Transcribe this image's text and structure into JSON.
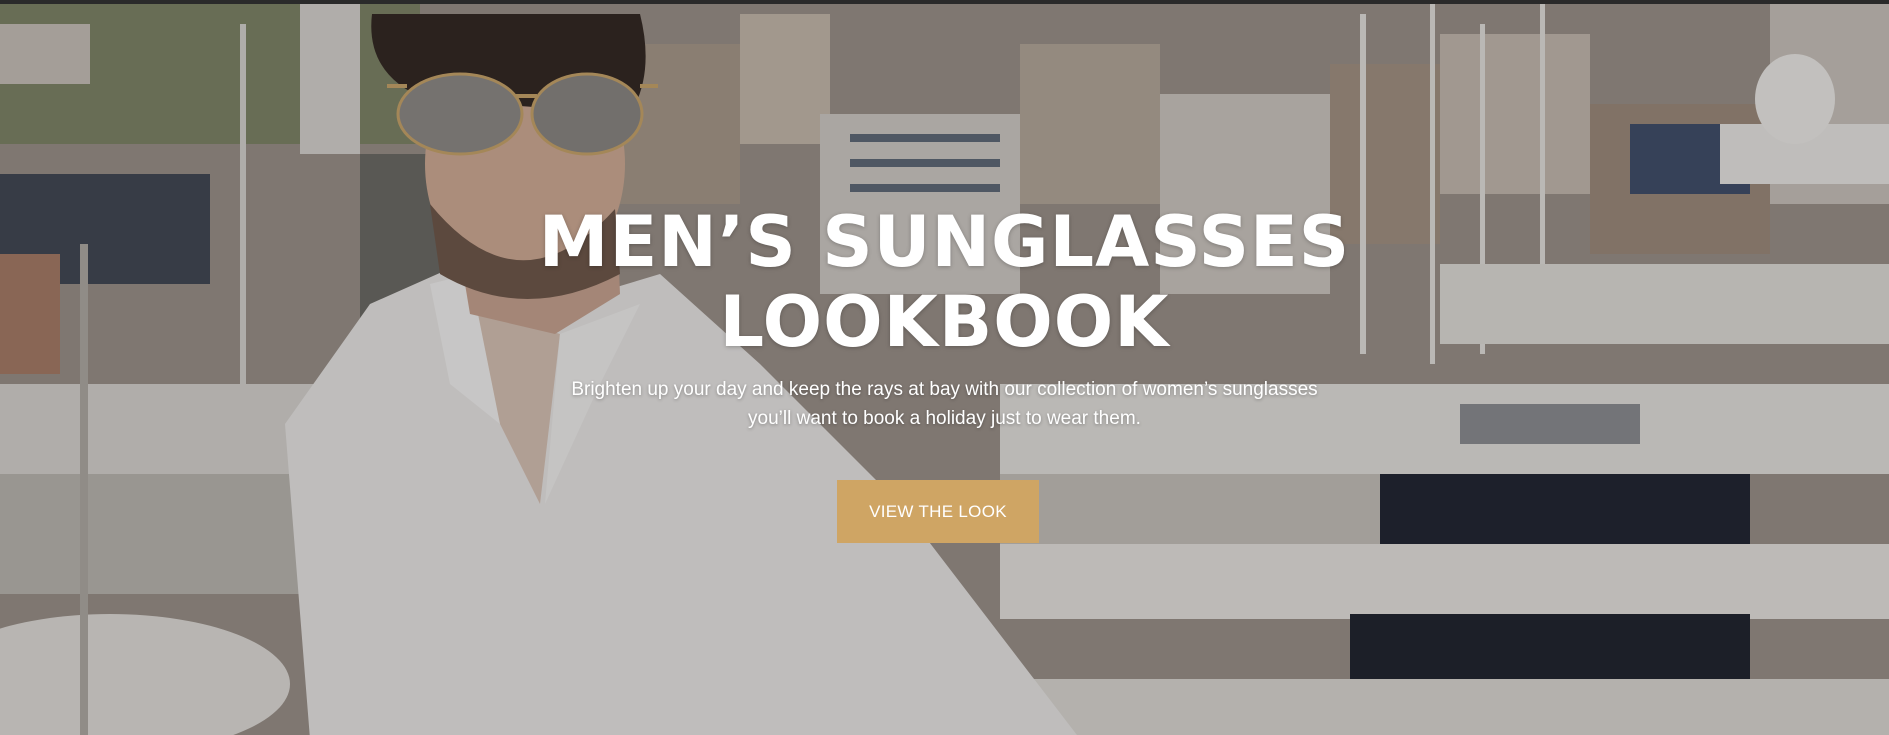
{
  "hero": {
    "title_line1": "MEN’S SUNGLASSES",
    "title_line2": "LOOKBOOK",
    "subtitle_line1": "Brighten up your day and keep the rays at bay with our collection of women’s sunglasses",
    "subtitle_line2": "you’ll want to book a holiday just to wear them.",
    "cta_label": "VIEW THE LOOK",
    "cta_color": "#cfa564",
    "background_image": "man-in-sunglasses-white-shirt-harbor-photo"
  }
}
